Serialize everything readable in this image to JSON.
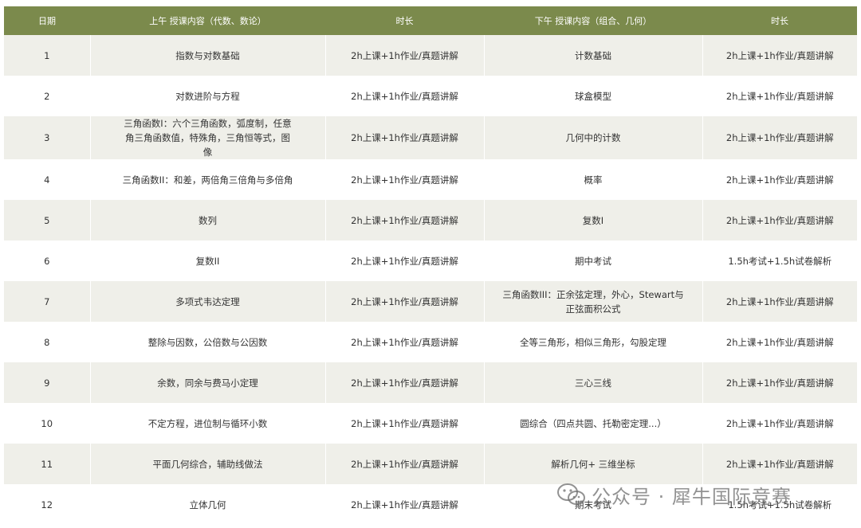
{
  "table": {
    "headers": [
      "日期",
      "上午 授课内容（代数、数论）",
      "时长",
      "下午 授课内容（组合、几何）",
      "时长"
    ],
    "rows": [
      [
        "1",
        "指数与对数基础",
        "2h上课+1h作业/真题讲解",
        "计数基础",
        "2h上课+1h作业/真题讲解"
      ],
      [
        "2",
        "对数进阶与方程",
        "2h上课+1h作业/真题讲解",
        "球盒模型",
        "2h上课+1h作业/真题讲解"
      ],
      [
        "3",
        "三角函数I：六个三角函数，弧度制，任意角三角函数值，特殊角，三角恒等式，图像",
        "2h上课+1h作业/真题讲解",
        "几何中的计数",
        "2h上课+1h作业/真题讲解"
      ],
      [
        "4",
        "三角函数II：和差，两倍角三倍角与多倍角",
        "2h上课+1h作业/真题讲解",
        "概率",
        "2h上课+1h作业/真题讲解"
      ],
      [
        "5",
        "数列",
        "2h上课+1h作业/真题讲解",
        "复数I",
        "2h上课+1h作业/真题讲解"
      ],
      [
        "6",
        "复数II",
        "2h上课+1h作业/真题讲解",
        "期中考试",
        "1.5h考试+1.5h试卷解析"
      ],
      [
        "7",
        "多项式韦达定理",
        "2h上课+1h作业/真题讲解",
        "三角函数III：正余弦定理，外心，Stewart与正弦面积公式",
        "2h上课+1h作业/真题讲解"
      ],
      [
        "8",
        "整除与因数，公倍数与公因数",
        "2h上课+1h作业/真题讲解",
        "全等三角形，相似三角形，勾股定理",
        "2h上课+1h作业/真题讲解"
      ],
      [
        "9",
        "余数，同余与费马小定理",
        "2h上课+1h作业/真题讲解",
        "三心三线",
        "2h上课+1h作业/真题讲解"
      ],
      [
        "10",
        "不定方程，进位制与循环小数",
        "2h上课+1h作业/真题讲解",
        "圆综合（四点共圆、托勒密定理...）",
        "2h上课+1h作业/真题讲解"
      ],
      [
        "11",
        "平面几何综合，辅助线做法",
        "2h上课+1h作业/真题讲解",
        "解析几何+ 三维坐标",
        "2h上课+1h作业/真题讲解"
      ],
      [
        "12",
        "立体几何",
        "2h上课+1h作业/真题讲解",
        "期末考试",
        "1.5h考试+1.5h试卷解析"
      ]
    ]
  },
  "watermark": {
    "text": "公众号 · 犀牛国际竞赛",
    "icon": "wechat-icon"
  },
  "colors": {
    "header_bg": "#7b8a4c",
    "header_text": "#ffffff",
    "row_alt": "#efefe9",
    "row_base": "#ffffff"
  }
}
